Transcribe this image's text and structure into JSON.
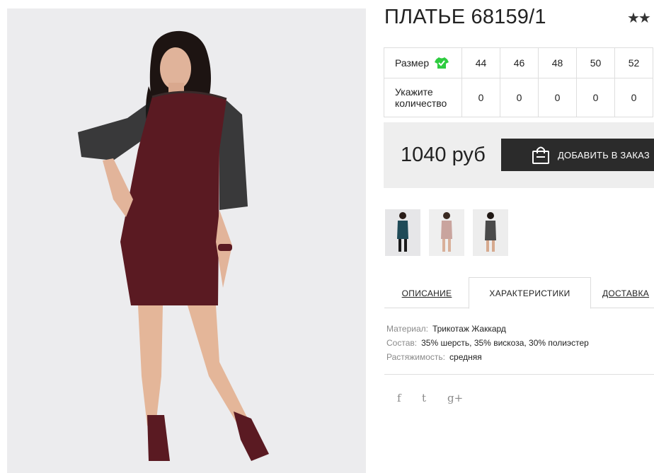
{
  "product": {
    "title": "ПЛАТЬЕ 68159/1",
    "stars": "★★"
  },
  "sizes": {
    "size_label": "Размер",
    "qty_label_line1": "Укажите",
    "qty_label_line2": "количество",
    "values": [
      "44",
      "46",
      "48",
      "50",
      "52"
    ],
    "quantities": [
      "0",
      "0",
      "0",
      "0",
      "0"
    ]
  },
  "price": {
    "amount": "1040 руб",
    "add_button": "ДОБАВИТЬ В ЗАКАЗ"
  },
  "tabs": {
    "description": "ОПИСАНИЕ",
    "characteristics": "ХАРАКТЕРИСТИКИ",
    "delivery": "ДОСТАВКА"
  },
  "specs": [
    {
      "label": "Материал:",
      "value": "Трикотаж Жаккард"
    },
    {
      "label": "Состав:",
      "value": "35% шерсть, 35% вискоза, 30% полиэстер"
    },
    {
      "label": "Растяжимость:",
      "value": "средняя"
    }
  ],
  "social": {
    "facebook": "f",
    "twitter": "t",
    "googleplus": "g+"
  },
  "colors": {
    "dress_main": "#5a1a22",
    "button_bg": "#2b2b2b",
    "size_icon": "#2ecc40",
    "price_bg": "#eeeeee"
  }
}
